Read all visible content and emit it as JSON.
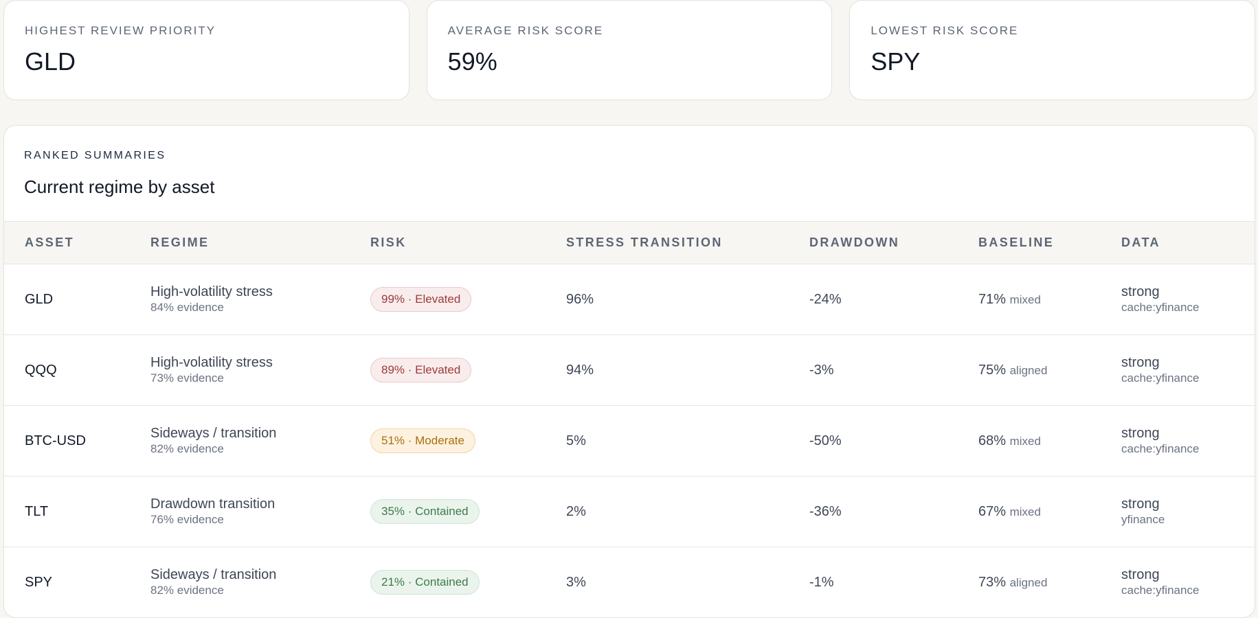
{
  "summary": [
    {
      "label": "HIGHEST REVIEW PRIORITY",
      "value": "GLD"
    },
    {
      "label": "AVERAGE RISK SCORE",
      "value": "59%"
    },
    {
      "label": "LOWEST RISK SCORE",
      "value": "SPY"
    }
  ],
  "panel": {
    "kicker": "RANKED SUMMARIES",
    "title": "Current regime by asset"
  },
  "table": {
    "headers": [
      "ASSET",
      "REGIME",
      "RISK",
      "STRESS TRANSITION",
      "DRAWDOWN",
      "BASELINE",
      "DATA"
    ],
    "rows": [
      {
        "asset": "GLD",
        "regime": "High-volatility stress",
        "evidence": "84% evidence",
        "risk": "99% · Elevated",
        "risk_level": "elevated",
        "stress": "96%",
        "drawdown": "-24%",
        "baseline": "71%",
        "baseline_tag": "mixed",
        "data": "strong",
        "source": "cache:yfinance"
      },
      {
        "asset": "QQQ",
        "regime": "High-volatility stress",
        "evidence": "73% evidence",
        "risk": "89% · Elevated",
        "risk_level": "elevated",
        "stress": "94%",
        "drawdown": "-3%",
        "baseline": "75%",
        "baseline_tag": "aligned",
        "data": "strong",
        "source": "cache:yfinance"
      },
      {
        "asset": "BTC-USD",
        "regime": "Sideways / transition",
        "evidence": "82% evidence",
        "risk": "51% · Moderate",
        "risk_level": "moderate",
        "stress": "5%",
        "drawdown": "-50%",
        "baseline": "68%",
        "baseline_tag": "mixed",
        "data": "strong",
        "source": "cache:yfinance"
      },
      {
        "asset": "TLT",
        "regime": "Drawdown transition",
        "evidence": "76% evidence",
        "risk": "35% · Contained",
        "risk_level": "contained",
        "stress": "2%",
        "drawdown": "-36%",
        "baseline": "67%",
        "baseline_tag": "mixed",
        "data": "strong",
        "source": "yfinance"
      },
      {
        "asset": "SPY",
        "regime": "Sideways / transition",
        "evidence": "82% evidence",
        "risk": "21% · Contained",
        "risk_level": "contained",
        "stress": "3%",
        "drawdown": "-1%",
        "baseline": "73%",
        "baseline_tag": "aligned",
        "data": "strong",
        "source": "cache:yfinance"
      }
    ]
  },
  "colors": {
    "elevated": "#9b3b3b",
    "moderate": "#a86e13",
    "contained": "#3e7a4c"
  }
}
